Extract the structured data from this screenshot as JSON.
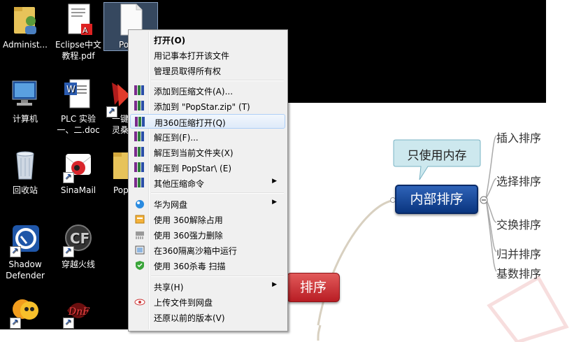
{
  "desktop": {
    "icons": [
      {
        "label": "Administ..."
      },
      {
        "label": "Eclipse中文\n教程.pdf"
      },
      {
        "label": "PopSt"
      },
      {
        "label": "计算机"
      },
      {
        "label": "PLC 实验\n一、二.doc"
      },
      {
        "label": "一键\n灵桑"
      },
      {
        "label": "回收站"
      },
      {
        "label": "SinaMail"
      },
      {
        "label": "Pop"
      },
      {
        "label": "Shadow\nDefender"
      },
      {
        "label": "穿越火线"
      }
    ]
  },
  "context_menu": {
    "items": [
      {
        "label": "打开(O)"
      },
      {
        "label": "用记事本打开该文件"
      },
      {
        "label": "管理员取得所有权"
      },
      {
        "label": "添加到压缩文件(A)..."
      },
      {
        "label": "添加到 \"PopStar.zip\" (T)"
      },
      {
        "label": "用360压缩打开(Q)"
      },
      {
        "label": "解压到(F)..."
      },
      {
        "label": "解压到当前文件夹(X)"
      },
      {
        "label": "解压到 PopStar\\ (E)"
      },
      {
        "label": "其他压缩命令"
      },
      {
        "label": "华为网盘"
      },
      {
        "label": "使用 360解除占用"
      },
      {
        "label": "使用 360强力删除"
      },
      {
        "label": "在360隔离沙箱中运行"
      },
      {
        "label": "使用 360杀毒 扫描"
      },
      {
        "label": "共享(H)"
      },
      {
        "label": "上传文件到网盘"
      },
      {
        "label": "还原以前的版本(V)"
      }
    ]
  },
  "mindmap": {
    "root": "排序",
    "center": "内部排序",
    "callout": "只使用内存",
    "branches": [
      "插入排序",
      "选择排序",
      "交换排序",
      "归并排序",
      "基数排序"
    ]
  },
  "colors": {
    "accent_blue": "#0d3d8f",
    "root_red": "#c8242a",
    "callout_bg": "#cde8ee"
  }
}
